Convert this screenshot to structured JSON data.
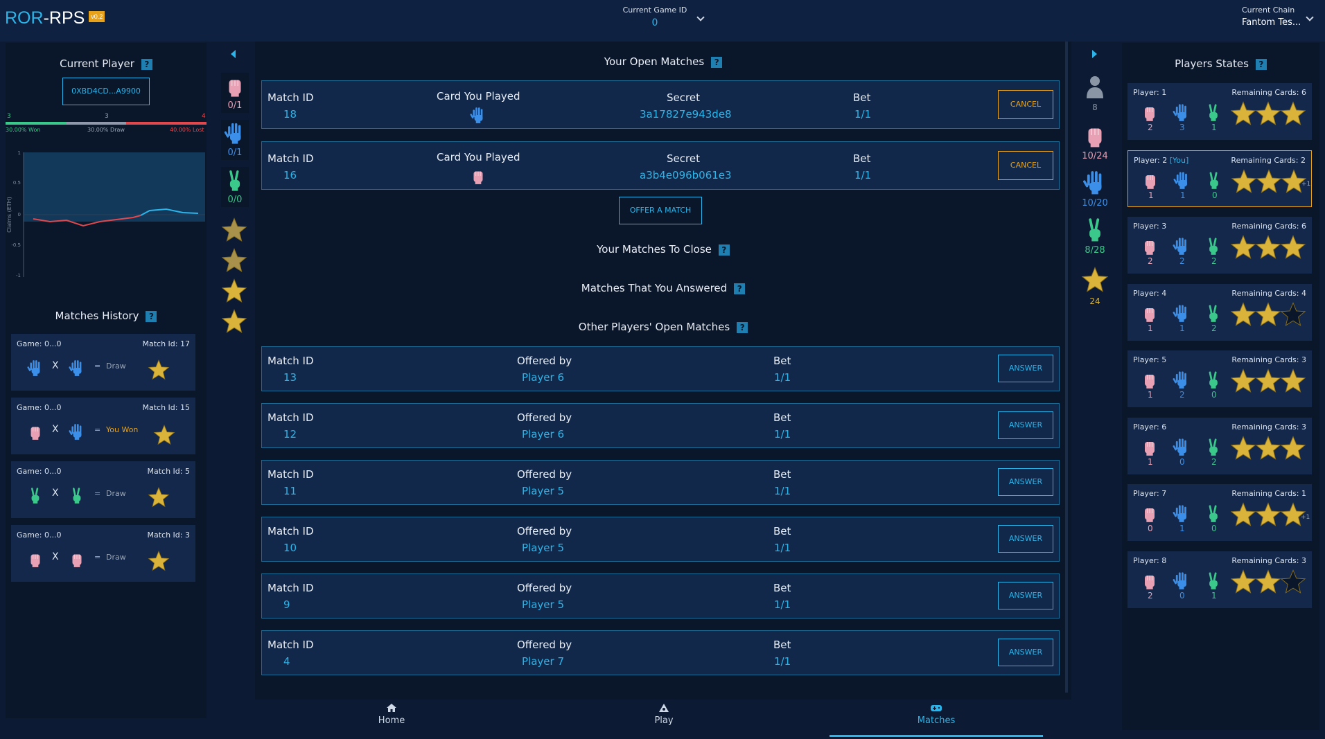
{
  "header": {
    "logo_ror": "ROR",
    "logo_rest": "-RPS",
    "version": "v0.2",
    "game_id_label": "Current Game ID",
    "game_id": "0",
    "chain_label": "Current Chain",
    "chain": "Fantom Tes..."
  },
  "current_player": {
    "title": "Current Player",
    "address": "0XBD4CD...A9900",
    "won_count": "3",
    "draw_count": "3",
    "lost_count": "4",
    "won_pct": "30.00% Won",
    "draw_pct": "30.00% Draw",
    "lost_pct": "40.00% Lost",
    "won_frac": 0.3,
    "draw_frac": 0.3,
    "lost_frac": 0.4
  },
  "claims_chart": {
    "ylabel": "Claims (ETH)",
    "yticks": [
      "1",
      "0.5",
      "0",
      "-0.5",
      "-1"
    ]
  },
  "history": {
    "title": "Matches History",
    "items": [
      {
        "game": "Game: 0...0",
        "match": "Match Id: 17",
        "result": "Draw"
      },
      {
        "game": "Game: 0...0",
        "match": "Match Id: 15",
        "result": "You Won"
      },
      {
        "game": "Game: 0...0",
        "match": "Match Id: 5",
        "result": "Draw"
      },
      {
        "game": "Game: 0...0",
        "match": "Match Id: 3",
        "result": "Draw"
      }
    ]
  },
  "eq": "=",
  "x": "X",
  "my_cards": {
    "rock": "0/1",
    "paper": "0/1",
    "scissors": "0/0"
  },
  "open_matches": {
    "title": "Your Open Matches",
    "rows": [
      {
        "id_label": "Match ID",
        "id": "18",
        "card_label": "Card You Played",
        "secret_label": "Secret",
        "secret": "3a17827e943de8",
        "bet_label": "Bet",
        "bet": "1/1",
        "btn": "CANCEL"
      },
      {
        "id_label": "Match ID",
        "id": "16",
        "card_label": "Card You Played",
        "secret_label": "Secret",
        "secret": "a3b4e096b061e3",
        "bet_label": "Bet",
        "bet": "1/1",
        "btn": "CANCEL"
      }
    ]
  },
  "offer_button": "OFFER A MATCH",
  "to_close_title": "Your Matches To Close",
  "answered_title": "Matches That You Answered",
  "other_matches": {
    "title": "Other Players' Open Matches",
    "rows": [
      {
        "id_label": "Match ID",
        "id": "13",
        "by_label": "Offered by",
        "by": "Player 6",
        "bet_label": "Bet",
        "bet": "1/1",
        "btn": "ANSWER"
      },
      {
        "id_label": "Match ID",
        "id": "12",
        "by_label": "Offered by",
        "by": "Player 6",
        "bet_label": "Bet",
        "bet": "1/1",
        "btn": "ANSWER"
      },
      {
        "id_label": "Match ID",
        "id": "11",
        "by_label": "Offered by",
        "by": "Player 5",
        "bet_label": "Bet",
        "bet": "1/1",
        "btn": "ANSWER"
      },
      {
        "id_label": "Match ID",
        "id": "10",
        "by_label": "Offered by",
        "by": "Player 5",
        "bet_label": "Bet",
        "bet": "1/1",
        "btn": "ANSWER"
      },
      {
        "id_label": "Match ID",
        "id": "9",
        "by_label": "Offered by",
        "by": "Player 5",
        "bet_label": "Bet",
        "bet": "1/1",
        "btn": "ANSWER"
      },
      {
        "id_label": "Match ID",
        "id": "4",
        "by_label": "Offered by",
        "by": "Player 7",
        "bet_label": "Bet",
        "bet": "1/1",
        "btn": "ANSWER"
      }
    ]
  },
  "totals": {
    "players": "8",
    "rock": "10/24",
    "paper": "10/20",
    "scissors": "8/28",
    "stars": "24"
  },
  "players_states": {
    "title": "Players States",
    "items": [
      {
        "player": "Player: 1",
        "you": "",
        "remaining": "Remaining Cards: 6",
        "rock": "2",
        "paper": "3",
        "scissors": "1",
        "stars": 3,
        "plus": ""
      },
      {
        "player": "Player: 2",
        "you": "[You]",
        "remaining": "Remaining Cards: 2",
        "rock": "1",
        "paper": "1",
        "scissors": "0",
        "stars": 3,
        "plus": "+1"
      },
      {
        "player": "Player: 3",
        "you": "",
        "remaining": "Remaining Cards: 6",
        "rock": "2",
        "paper": "2",
        "scissors": "2",
        "stars": 3,
        "plus": ""
      },
      {
        "player": "Player: 4",
        "you": "",
        "remaining": "Remaining Cards: 4",
        "rock": "1",
        "paper": "1",
        "scissors": "2",
        "stars": 2,
        "plus": ""
      },
      {
        "player": "Player: 5",
        "you": "",
        "remaining": "Remaining Cards: 3",
        "rock": "1",
        "paper": "2",
        "scissors": "0",
        "stars": 3,
        "plus": ""
      },
      {
        "player": "Player: 6",
        "you": "",
        "remaining": "Remaining Cards: 3",
        "rock": "1",
        "paper": "0",
        "scissors": "2",
        "stars": 3,
        "plus": ""
      },
      {
        "player": "Player: 7",
        "you": "",
        "remaining": "Remaining Cards: 1",
        "rock": "0",
        "paper": "1",
        "scissors": "0",
        "stars": 3,
        "plus": "+1"
      },
      {
        "player": "Player: 8",
        "you": "",
        "remaining": "Remaining Cards: 3",
        "rock": "2",
        "paper": "0",
        "scissors": "1",
        "stars": 2,
        "plus": ""
      }
    ]
  },
  "nav": {
    "home": "Home",
    "play": "Play",
    "matches": "Matches"
  },
  "colors": {
    "rock": "#e8a0b4",
    "paper": "#3c8fe8",
    "scissors": "#3ac98a",
    "star": "#d9b33a",
    "accent": "#2bb5ea",
    "cancel": "#e8a21a"
  }
}
